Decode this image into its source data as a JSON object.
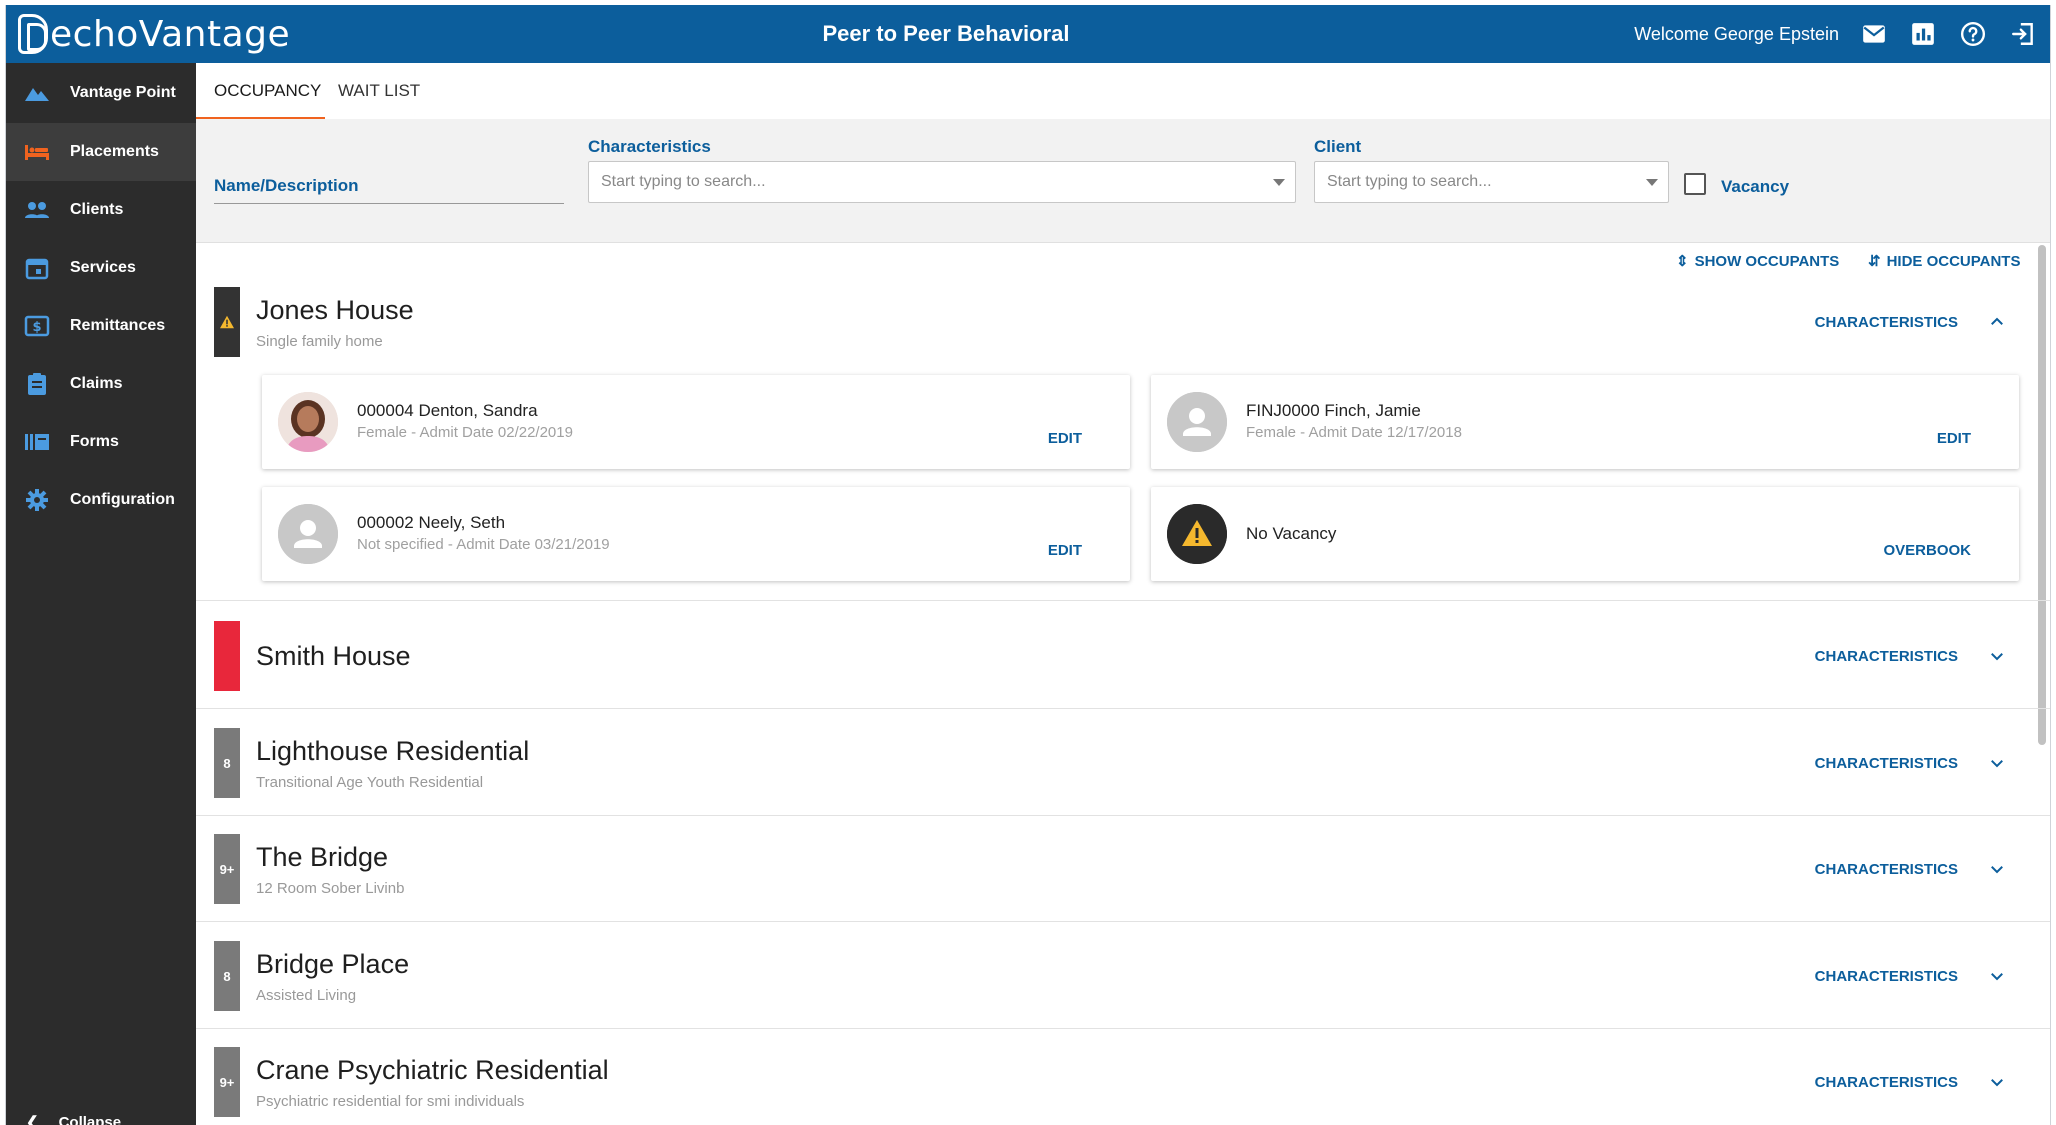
{
  "header": {
    "logo_text": "echoVantage",
    "title": "Peer to Peer Behavioral",
    "welcome": "Welcome George Epstein",
    "icons": [
      "mail-icon",
      "report-icon",
      "help-icon",
      "logout-icon"
    ]
  },
  "sidebar": {
    "items": [
      {
        "label": "Vantage Point",
        "icon": "mountain-icon"
      },
      {
        "label": "Placements",
        "icon": "bed-icon",
        "active": true
      },
      {
        "label": "Clients",
        "icon": "people-icon"
      },
      {
        "label": "Services",
        "icon": "calendar-icon"
      },
      {
        "label": "Remittances",
        "icon": "dollar-icon"
      },
      {
        "label": "Claims",
        "icon": "clipboard-icon"
      },
      {
        "label": "Forms",
        "icon": "forms-icon"
      },
      {
        "label": "Configuration",
        "icon": "gear-icon"
      }
    ],
    "collapse_label": "Collapse"
  },
  "tabs": [
    {
      "label": "OCCUPANCY",
      "active": true
    },
    {
      "label": "WAIT LIST",
      "active": false
    }
  ],
  "filters": {
    "name_label": "Name/Description",
    "characteristics_label": "Characteristics",
    "characteristics_placeholder": "Start typing to search...",
    "client_label": "Client",
    "client_placeholder": "Start typing to search...",
    "vacancy_label": "Vacancy"
  },
  "toggles": {
    "show": "SHOW OCCUPANTS",
    "hide": "HIDE OCCUPANTS"
  },
  "characteristics_label": "CHARACTERISTICS",
  "houses": [
    {
      "name": "Jones House",
      "description": "Single family home",
      "flag": "",
      "flag_color": "#333333",
      "expanded": true
    },
    {
      "name": "Smith House",
      "description": "",
      "flag": "",
      "flag_color": "#e8273b",
      "expanded": false
    },
    {
      "name": "Lighthouse Residential",
      "description": "Transitional Age Youth Residential",
      "flag": "8",
      "flag_color": "#7a7a7a",
      "expanded": false
    },
    {
      "name": "The Bridge",
      "description": "12 Room Sober Livinb",
      "flag": "9+",
      "flag_color": "#7a7a7a",
      "expanded": false
    },
    {
      "name": "Bridge Place",
      "description": "Assisted Living",
      "flag": "8",
      "flag_color": "#7a7a7a",
      "expanded": false
    },
    {
      "name": "Crane Psychiatric Residential",
      "description": "Psychiatric residential for smi individuals",
      "flag": "9+",
      "flag_color": "#7a7a7a",
      "expanded": false
    }
  ],
  "occupants": [
    {
      "name": "000004 Denton, Sandra",
      "meta": "Female - Admit Date 02/22/2019",
      "action": "EDIT",
      "avatar": "photo"
    },
    {
      "name": "FINJ0000 Finch, Jamie",
      "meta": "Female - Admit Date 12/17/2018",
      "action": "EDIT",
      "avatar": "placeholder"
    },
    {
      "name": "000002 Neely, Seth",
      "meta": "Not specified - Admit Date 03/21/2019",
      "action": "EDIT",
      "avatar": "placeholder"
    },
    {
      "name": "No Vacancy",
      "meta": "",
      "action": "OVERBOOK",
      "avatar": "warning"
    }
  ],
  "colors": {
    "brand": "#0c5e9c",
    "accent": "#f0631f",
    "sidebar": "#2c2c2c",
    "warning": "#f5b82e"
  }
}
